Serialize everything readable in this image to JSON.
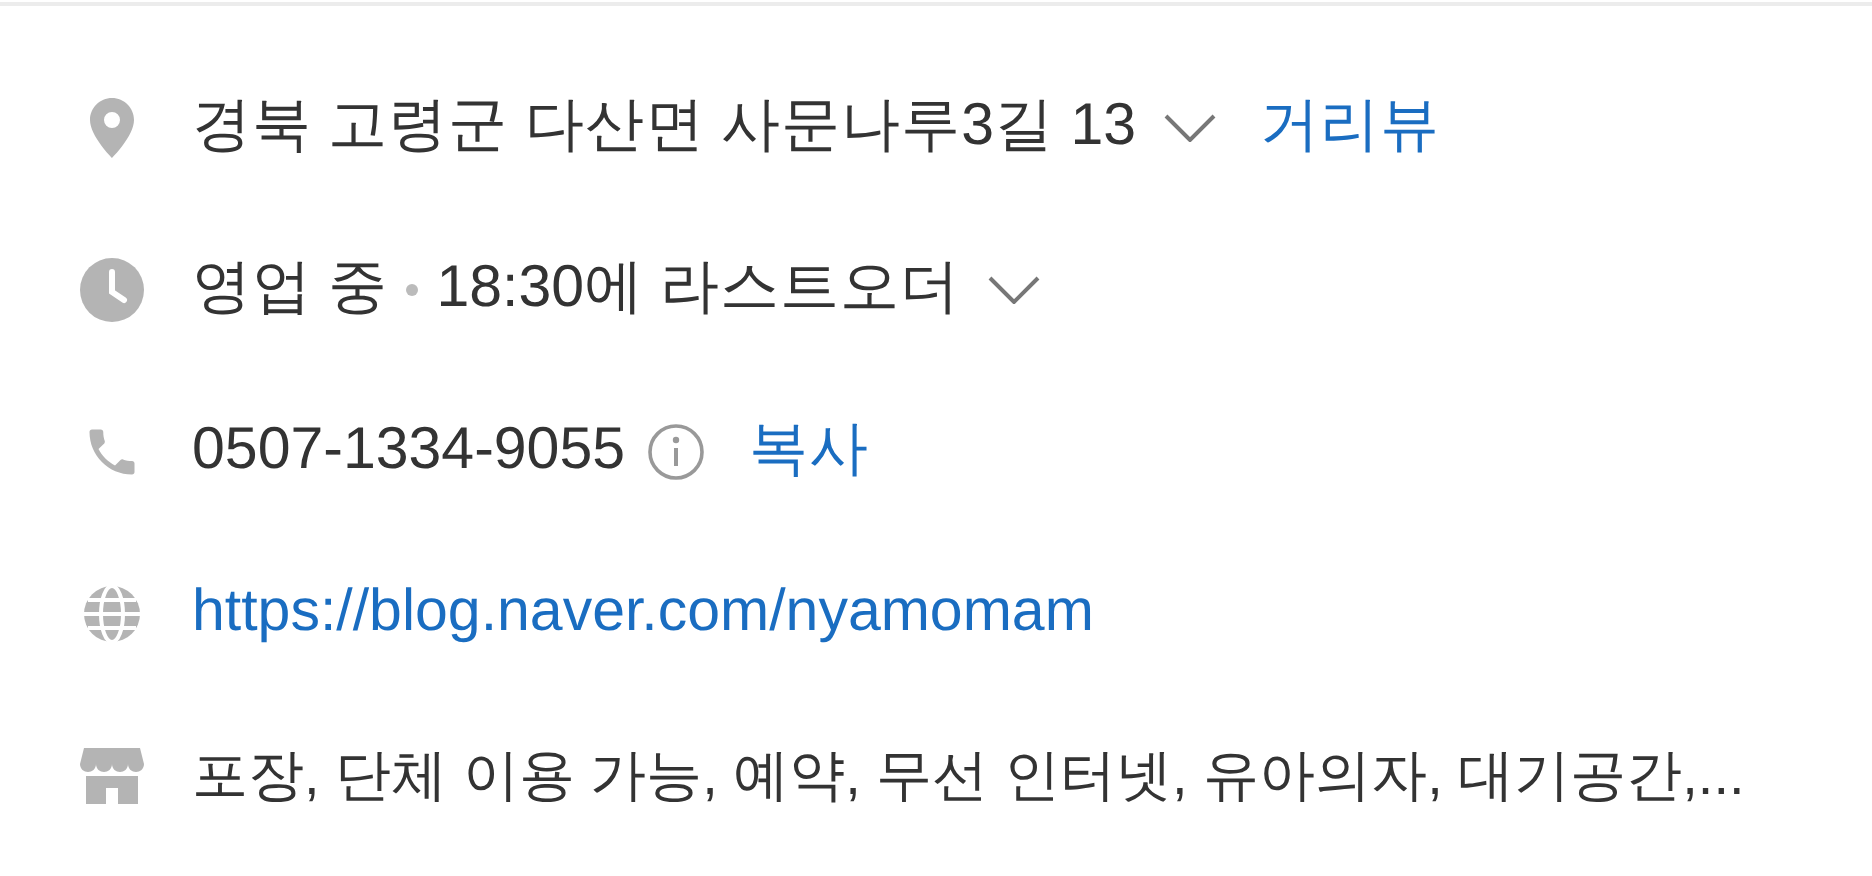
{
  "rows": [
    {
      "kind": "address",
      "text": "경북 고령군 다산면 사문나루3길 13",
      "expandable": true,
      "link": "거리뷰"
    },
    {
      "kind": "hours",
      "status": "영업 중",
      "text": "18:30에 라스트오더",
      "expandable": true
    },
    {
      "kind": "phone",
      "text": "0507-1334-9055",
      "link": "복사"
    },
    {
      "kind": "website",
      "link": "https://blog.naver.com/nyamomam"
    },
    {
      "kind": "amenities",
      "text": "포장, 단체 이용 가능, 예약, 무선 인터넷, 유아의자, 대기공간,..."
    }
  ]
}
